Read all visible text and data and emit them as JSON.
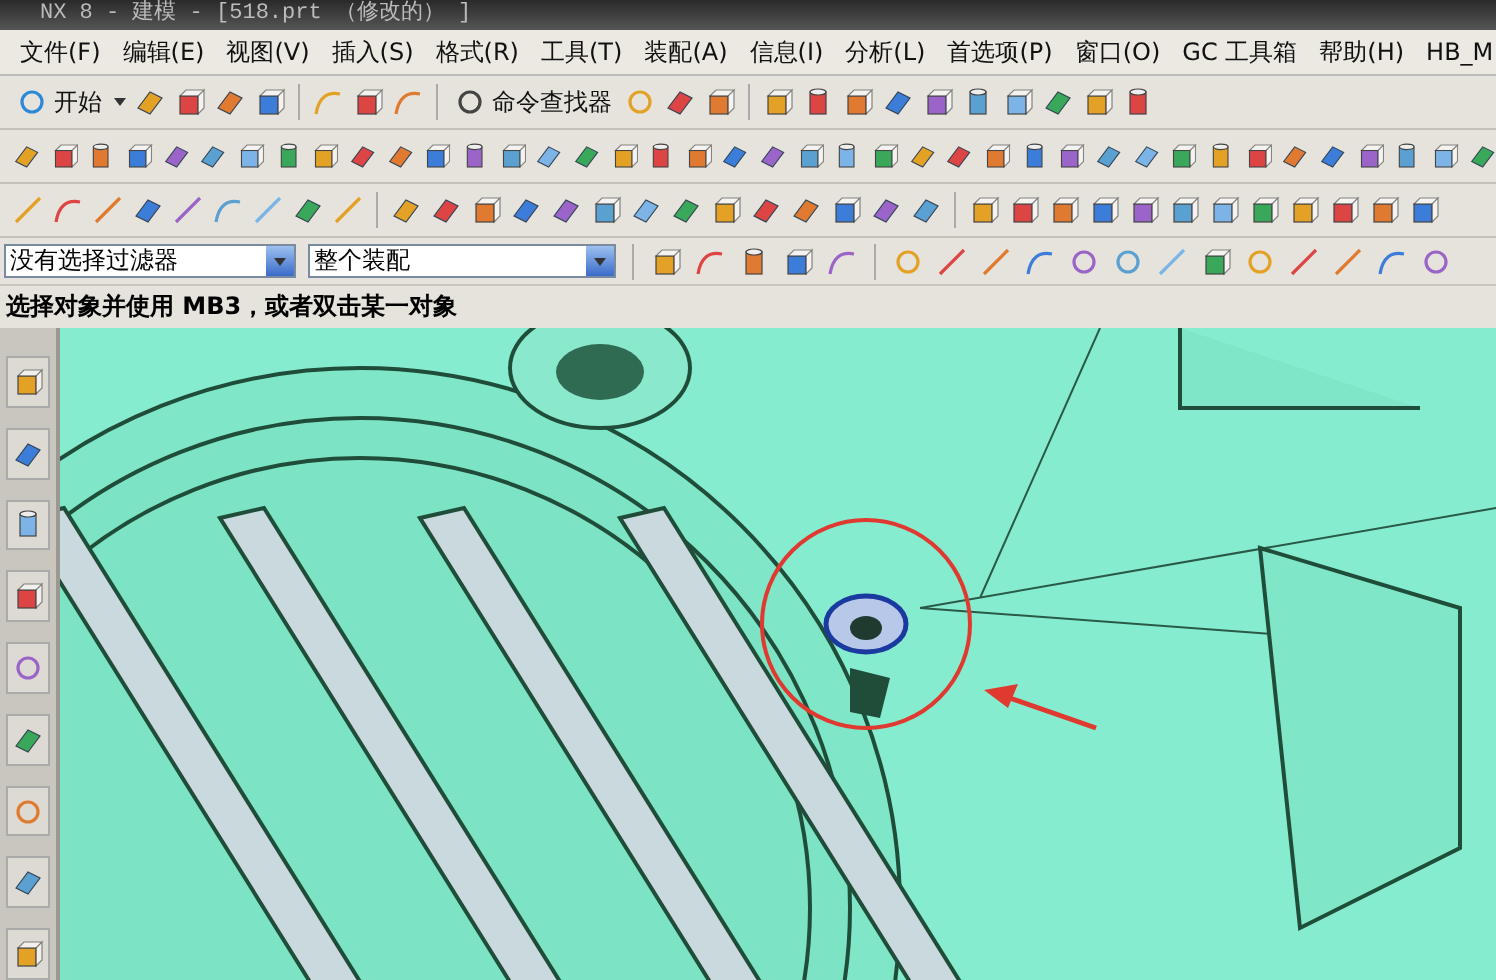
{
  "window": {
    "title": "NX 8 - 建模 - [518.prt （修改的） ]"
  },
  "menu": [
    "文件(F)",
    "编辑(E)",
    "视图(V)",
    "插入(S)",
    "格式(R)",
    "工具(T)",
    "装配(A)",
    "信息(I)",
    "分析(L)",
    "首选项(P)",
    "窗口(O)",
    "GC 工具箱",
    "帮助(H)",
    "HB_M"
  ],
  "toolbar": {
    "start": "开始",
    "command_finder": "命令查找器"
  },
  "selection_bar": {
    "type_filter": "没有选择过滤器",
    "scope": "整个装配"
  },
  "status_prompt": "选择对象并使用 MB3，或者双击某一对象"
}
